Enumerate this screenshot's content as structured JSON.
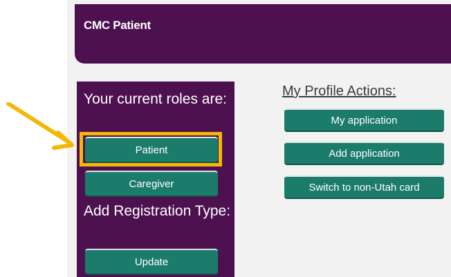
{
  "header": {
    "title": "CMC Patient"
  },
  "roles": {
    "heading": "Your current roles are:",
    "buttons": [
      {
        "label": "Patient",
        "highlighted": true
      },
      {
        "label": "Caregiver"
      }
    ]
  },
  "registration": {
    "heading": "Add Registration Type:",
    "update_label": "Update"
  },
  "profile_actions": {
    "heading": "My Profile Actions:",
    "buttons": [
      {
        "label": "My application"
      },
      {
        "label": "Add application"
      },
      {
        "label": "Switch to non-Utah card"
      }
    ]
  },
  "colors": {
    "header_bg": "#4d1150",
    "button_bg": "#1c7c6c",
    "highlight": "#f5b705",
    "page_bg": "#f2f2f2"
  },
  "annotation": {
    "icon": "pointer-arrow-icon"
  }
}
